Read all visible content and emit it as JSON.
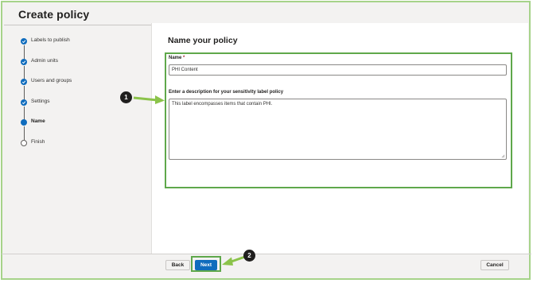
{
  "header": {
    "title": "Create policy"
  },
  "steps": [
    {
      "label": "Labels to publish",
      "state": "done"
    },
    {
      "label": "Admin units",
      "state": "done"
    },
    {
      "label": "Users and groups",
      "state": "done"
    },
    {
      "label": "Settings",
      "state": "done"
    },
    {
      "label": "Name",
      "state": "current"
    },
    {
      "label": "Finish",
      "state": "pending"
    }
  ],
  "main": {
    "heading": "Name your policy",
    "name_label": "Name",
    "required_marker": "*",
    "name_value": "PHI Content",
    "description_label": "Enter a description for your sensitivity label policy",
    "description_value": "This label encompasses items that contain PHI."
  },
  "footer": {
    "back_label": "Back",
    "next_label": "Next",
    "cancel_label": "Cancel"
  },
  "callouts": {
    "one": "1",
    "two": "2"
  },
  "colors": {
    "accent": "#0f6cbd",
    "highlight": "#5fa84b",
    "callout_bg": "#201f1e"
  },
  "icons": {
    "step_done": "checkmark-icon",
    "step_current": "filled-circle-icon",
    "step_pending": "empty-circle-icon"
  }
}
